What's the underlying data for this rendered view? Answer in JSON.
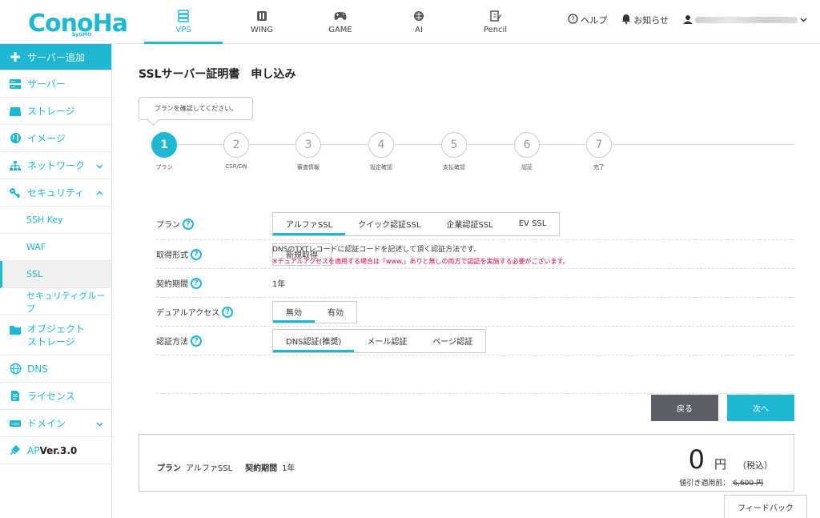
{
  "brand": {
    "name": "ConoHa",
    "sub": "byGMO",
    "color": "#1fb8d4"
  },
  "topnav": [
    {
      "label": "VPS",
      "icon": "server-icon",
      "active": true
    },
    {
      "label": "WING",
      "icon": "wing-icon"
    },
    {
      "label": "GAME",
      "icon": "gamepad-icon"
    },
    {
      "label": "AI",
      "icon": "brain-icon"
    },
    {
      "label": "Pencil",
      "icon": "pencil-icon"
    }
  ],
  "header_right": {
    "help": "ヘルプ",
    "notice": "お知らせ"
  },
  "sidebar": {
    "add": "サーバー追加",
    "server": "サーバー",
    "storage": "ストレージ",
    "image": "イメージ",
    "network": "ネットワーク",
    "security": "セキュリティ",
    "ssh": "SSH Key",
    "waf": "WAF",
    "ssl": "SSL",
    "secgroup": "セキュリティグループ",
    "object1": "オブジェクト",
    "object2": "ストレージ",
    "dns": "DNS",
    "license": "ライセンス",
    "domain": "ドメイン",
    "api_prefix": "AP",
    "api_version": "Ver.3.0"
  },
  "page": {
    "title": "SSLサーバー証明書　申し込み",
    "tooltip": "プランを確認してください。"
  },
  "steps": [
    {
      "num": "1",
      "label": "プラン"
    },
    {
      "num": "2",
      "label": "CSR/DN"
    },
    {
      "num": "3",
      "label": "審査情報"
    },
    {
      "num": "4",
      "label": "設定確認"
    },
    {
      "num": "5",
      "label": "支払確認"
    },
    {
      "num": "6",
      "label": "認証"
    },
    {
      "num": "7",
      "label": "完了"
    }
  ],
  "form": {
    "plan_label": "プラン",
    "plan_options": [
      "アルファSSL",
      "クイック認証SSL",
      "企業認証SSL",
      "EV SSL"
    ],
    "type_label": "取得形式",
    "type_option": "新規取得",
    "period_label": "契約期間",
    "period_value": "1年",
    "dual_label": "デュアルアクセス",
    "dual_options": [
      "無効",
      "有効"
    ],
    "auth_label": "認証方法",
    "auth_options": [
      "DNS認証(推奨)",
      "メール認証",
      "ページ認証"
    ],
    "desc": "DNSのTXTレコードに認証コードを記述して頂く認証方法です。",
    "warning": "※デュアルアクセスを適用する場合は「www.」ありと無しの両方で認証を実施する必要がございます。"
  },
  "buttons": {
    "back": "戻る",
    "next": "次へ"
  },
  "summary": {
    "plan_label": "プラン",
    "plan_value": "アルファSSL",
    "period_label": "契約期間",
    "period_value": "1年",
    "price": "0",
    "yen": "円",
    "tax": "（税込）",
    "pre_label": "値引き適用前：",
    "pre_value": "6,600 円"
  },
  "feedback": "フィードバック"
}
